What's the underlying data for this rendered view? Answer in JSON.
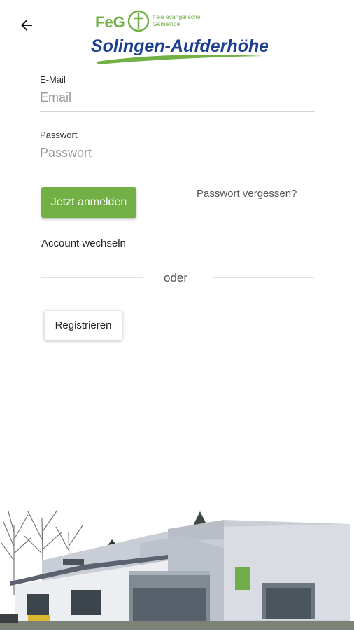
{
  "header": {
    "back_icon": "arrow-left-icon",
    "logo": {
      "acronym": "FeG",
      "tagline_line1": "freie evangelische",
      "tagline_line2": "Gemeinde",
      "location": "Solingen-Aufderhöhe",
      "colors": {
        "green": "#72b046",
        "blue": "#1d3f8f"
      }
    }
  },
  "form": {
    "email": {
      "label": "E-Mail",
      "value": "",
      "placeholder": "Email"
    },
    "password": {
      "label": "Passwort",
      "value": "",
      "placeholder": "Passwort"
    }
  },
  "actions": {
    "login_label": "Jetzt anmelden",
    "forgot_label": "Passwort vergessen?",
    "switch_account_label": "Account wechseln",
    "or_label": "oder",
    "register_label": "Registrieren"
  },
  "colors": {
    "accent": "#72b046",
    "divider": "#e3e3e3"
  }
}
